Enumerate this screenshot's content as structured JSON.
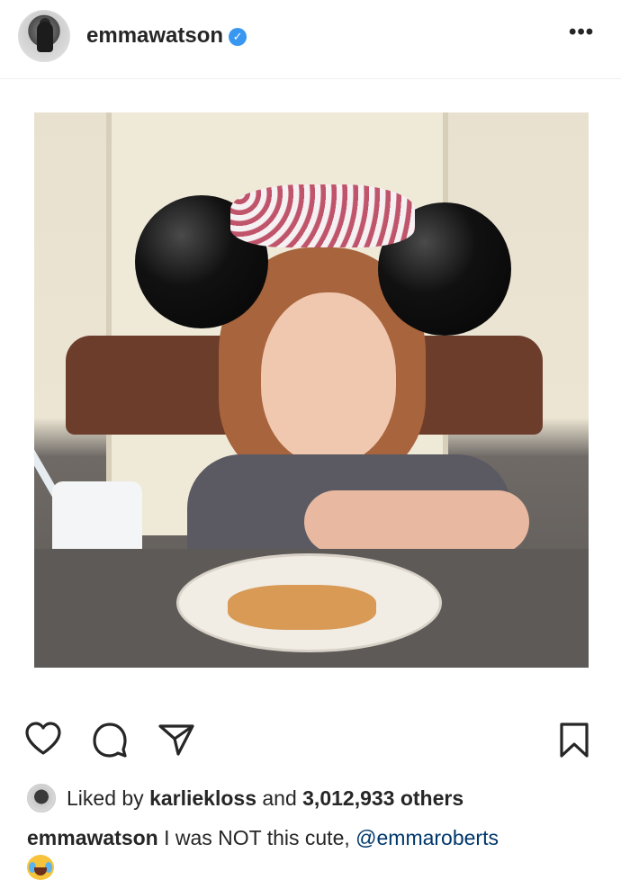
{
  "post": {
    "username": "emmawatson",
    "verified_glyph": "✓",
    "more_glyph": "•••"
  },
  "photo": {
    "description_icon": "photo-image"
  },
  "actions": {
    "like_icon": "heart-icon",
    "comment_icon": "comment-icon",
    "share_icon": "send-icon",
    "save_icon": "bookmark-icon"
  },
  "likes": {
    "prefix": "Liked by ",
    "user": "karliekloss",
    "middle": " and ",
    "count": "3,012,933 others"
  },
  "caption": {
    "username": "emmawatson",
    "text": " I was NOT this cute, ",
    "mention": "@emmaroberts"
  },
  "colors": {
    "text": "#262626",
    "verified": "#3897f0",
    "mention": "#00376b"
  }
}
